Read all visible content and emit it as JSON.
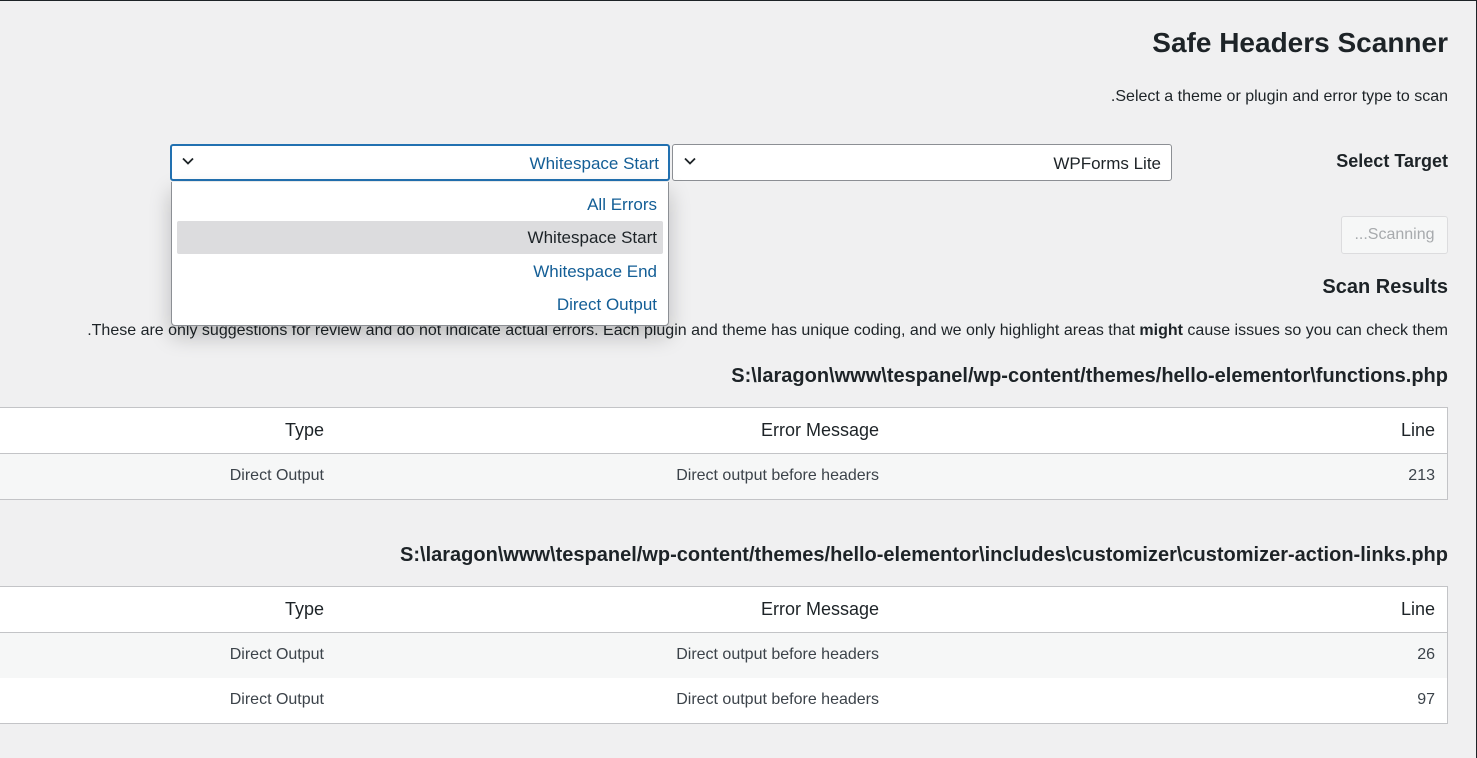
{
  "header": {
    "title": "Safe Headers Scanner",
    "subtitle": ".Select a theme or plugin and error type to scan"
  },
  "target": {
    "label": "Select Target",
    "plugin_select": {
      "value": "WPForms Lite"
    },
    "error_select": {
      "value": "Whitespace Start",
      "options": [
        "All Errors",
        "Whitespace Start",
        "Whitespace End",
        "Direct Output"
      ],
      "selected_index": 1
    }
  },
  "scan_button": {
    "label": "...Scanning"
  },
  "results": {
    "title": "Scan Results",
    "note_before": ".These are only suggestions for review and do not indicate actual errors. Each plugin and theme has unique coding, and we only highlight areas that ",
    "note_bold": "might",
    "note_after": " cause issues so you can check them",
    "columns": {
      "type": "Type",
      "message": "Error Message",
      "line": "Line"
    },
    "files": [
      {
        "path": "S:\\laragon\\www\\tespanel/wp-content/themes/hello-elementor\\functions.php",
        "rows": [
          {
            "type": "Direct Output",
            "message": "Direct output before headers",
            "line": "213"
          }
        ]
      },
      {
        "path": "S:\\laragon\\www\\tespanel/wp-content/themes/hello-elementor\\includes\\customizer\\customizer-action-links.php",
        "rows": [
          {
            "type": "Direct Output",
            "message": "Direct output before headers",
            "line": "26"
          },
          {
            "type": "Direct Output",
            "message": "Direct output before headers",
            "line": "97"
          }
        ]
      }
    ]
  },
  "colors": {
    "background": "#f0f0f1",
    "link": "#135e96",
    "focus_border": "#2271b1",
    "selected_option_bg": "#dcdcde",
    "table_border": "#c3c4c7"
  },
  "icons": {
    "select_arrow": "chevron-down-icon"
  }
}
